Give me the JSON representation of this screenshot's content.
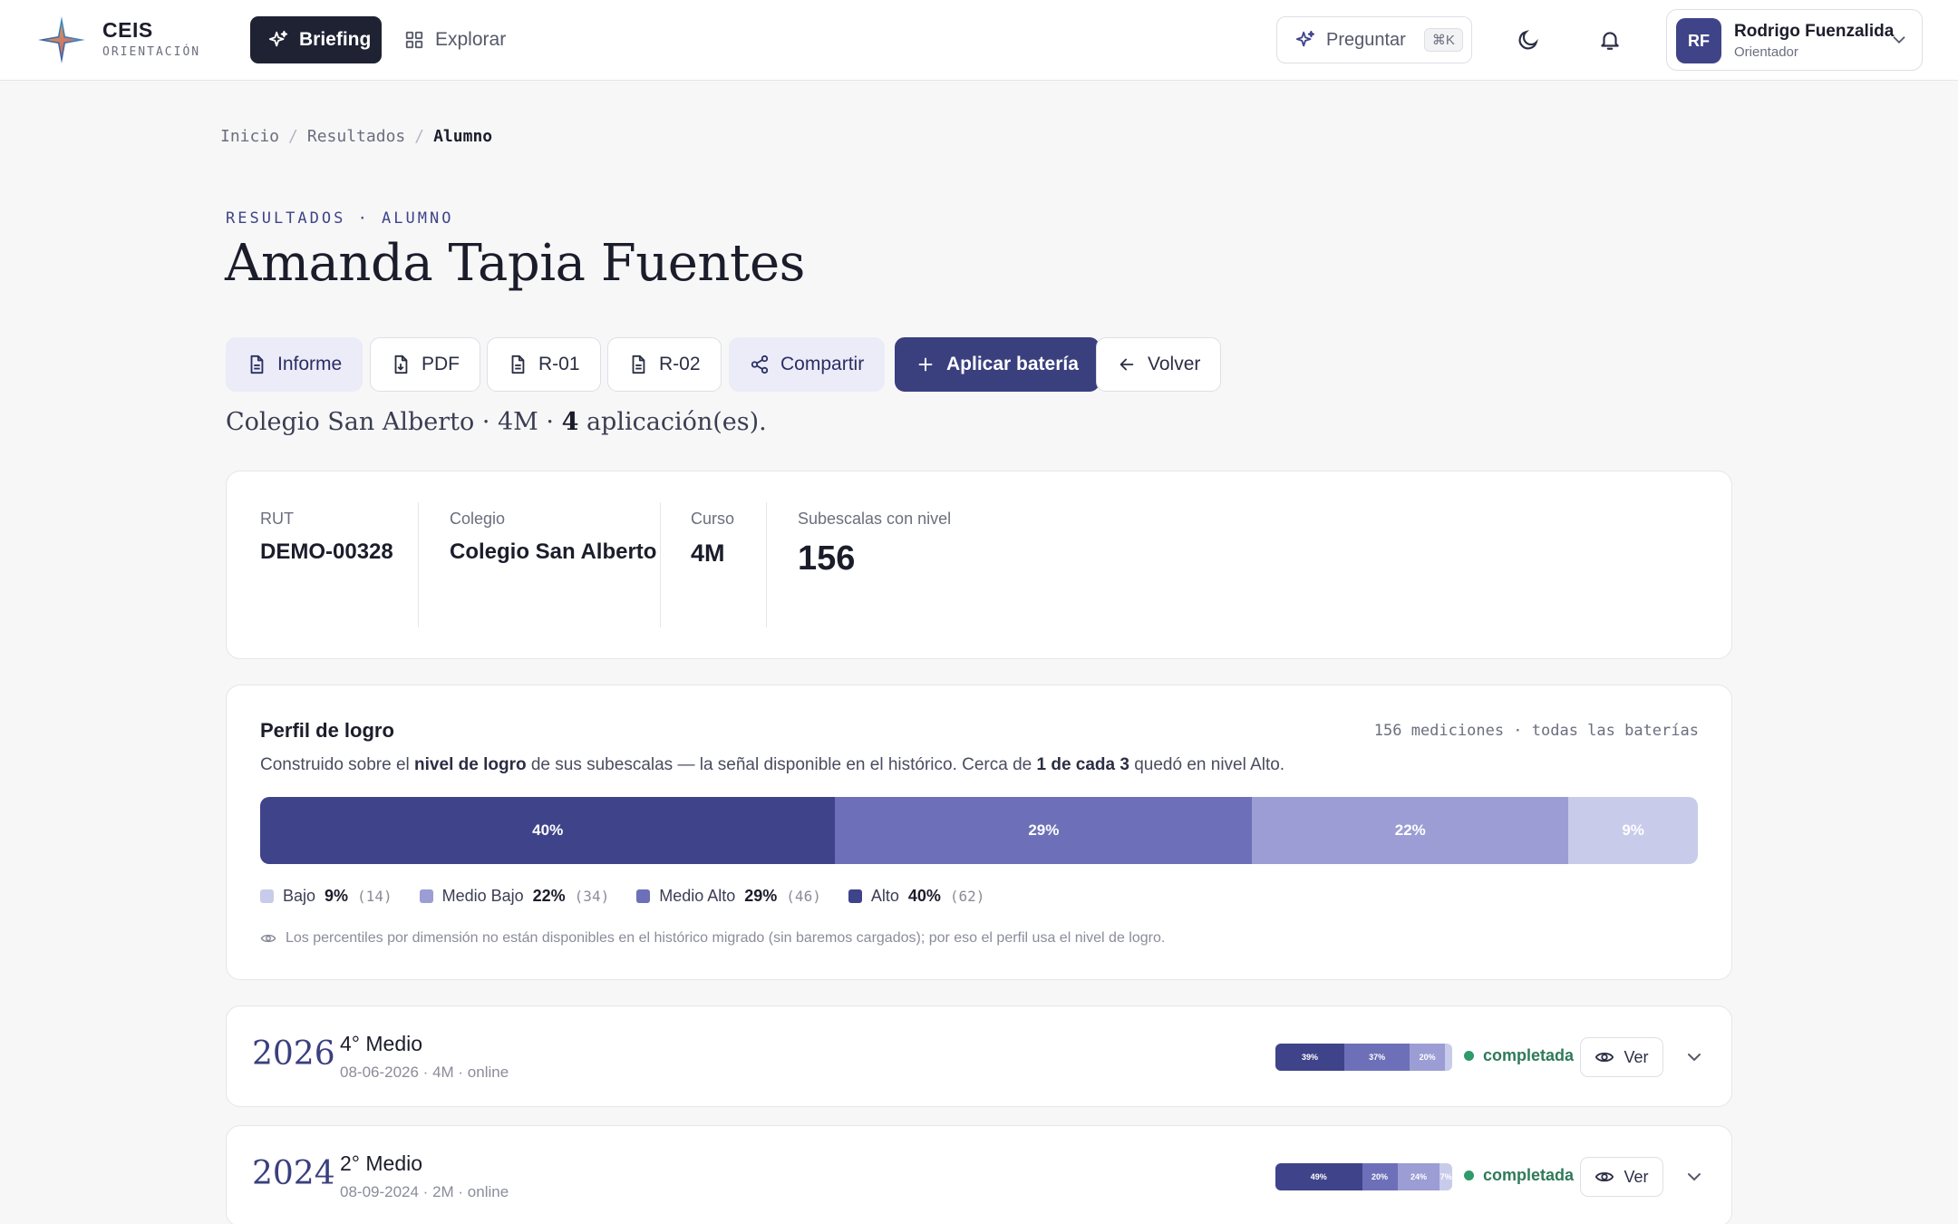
{
  "brand": {
    "name": "CEIS",
    "subtitle": "ORIENTACIÓN"
  },
  "nav": {
    "briefing": "Briefing",
    "explorar": "Explorar"
  },
  "ask": {
    "label": "Preguntar",
    "shortcut": "⌘K"
  },
  "user": {
    "initials": "RF",
    "name": "Rodrigo Fuenzalida",
    "role": "Orientador"
  },
  "breadcrumb": {
    "items": [
      "Inicio",
      "Resultados",
      "Alumno"
    ],
    "separator": "/"
  },
  "page": {
    "eyebrow": "RESULTADOS · ALUMNO",
    "title": "Amanda Tapia Fuentes",
    "summary_prefix": "Colegio San Alberto · 4M · ",
    "summary_count": "4",
    "summary_suffix": " aplicación(es)."
  },
  "actions": {
    "informe": "Informe",
    "pdf": "PDF",
    "r01": "R-01",
    "r02": "R-02",
    "compartir": "Compartir",
    "aplicar": "Aplicar batería",
    "volver": "Volver"
  },
  "stats": {
    "rut_label": "RUT",
    "rut_value": "DEMO-00328",
    "colegio_label": "Colegio",
    "colegio_value": "Colegio San Alberto",
    "curso_label": "Curso",
    "curso_value": "4M",
    "subescalas_label": "Subescalas con nivel",
    "subescalas_value": "156"
  },
  "profile": {
    "title": "Perfil de logro",
    "meta": "156 mediciones · todas las baterías",
    "desc_1": "Construido sobre el ",
    "desc_b1": "nivel de logro",
    "desc_2": " de sus subescalas — la señal disponible en el histórico. Cerca de ",
    "desc_b2": "1 de cada 3",
    "desc_3": " quedó en nivel Alto.",
    "bar": [
      {
        "level": "Alto",
        "percent": 40,
        "label": "40%",
        "color": "#3f438a"
      },
      {
        "level": "Medio Alto",
        "percent": 29,
        "label": "29%",
        "color": "#6d70b8"
      },
      {
        "level": "Medio Bajo",
        "percent": 22,
        "label": "22%",
        "color": "#9b9dd4"
      },
      {
        "level": "Bajo",
        "percent": 9,
        "label": "9%",
        "color": "#c9cbea"
      }
    ],
    "legend": [
      {
        "name": "Bajo",
        "pct": "9%",
        "count": "(14)",
        "color": "#c9cbea"
      },
      {
        "name": "Medio Bajo",
        "pct": "22%",
        "count": "(34)",
        "color": "#9b9dd4"
      },
      {
        "name": "Medio Alto",
        "pct": "29%",
        "count": "(46)",
        "color": "#6d70b8"
      },
      {
        "name": "Alto",
        "pct": "40%",
        "count": "(62)",
        "color": "#3f438a"
      }
    ],
    "note": "Los percentiles por dimensión no están disponibles en el histórico migrado (sin baremos cargados); por eso el perfil usa el nivel de logro."
  },
  "applications": [
    {
      "year": "2026",
      "grade": "4° Medio",
      "info": "08-06-2026 · 4M · online",
      "status": "completada",
      "view": "Ver",
      "bar": [
        {
          "percent": 39,
          "label": "39%",
          "color": "#3f438a"
        },
        {
          "percent": 37,
          "label": "37%",
          "color": "#6d70b8"
        },
        {
          "percent": 20,
          "label": "20%",
          "color": "#9b9dd4"
        },
        {
          "percent": 4,
          "label": "",
          "color": "#c9cbea"
        }
      ]
    },
    {
      "year": "2024",
      "grade": "2° Medio",
      "info": "08-09-2024 · 2M · online",
      "status": "completada",
      "view": "Ver",
      "bar": [
        {
          "percent": 49,
          "label": "49%",
          "color": "#3f438a"
        },
        {
          "percent": 20,
          "label": "20%",
          "color": "#6d70b8"
        },
        {
          "percent": 24,
          "label": "24%",
          "color": "#9b9dd4"
        },
        {
          "percent": 7,
          "label": "7%",
          "color": "#c9cbea"
        }
      ]
    }
  ]
}
